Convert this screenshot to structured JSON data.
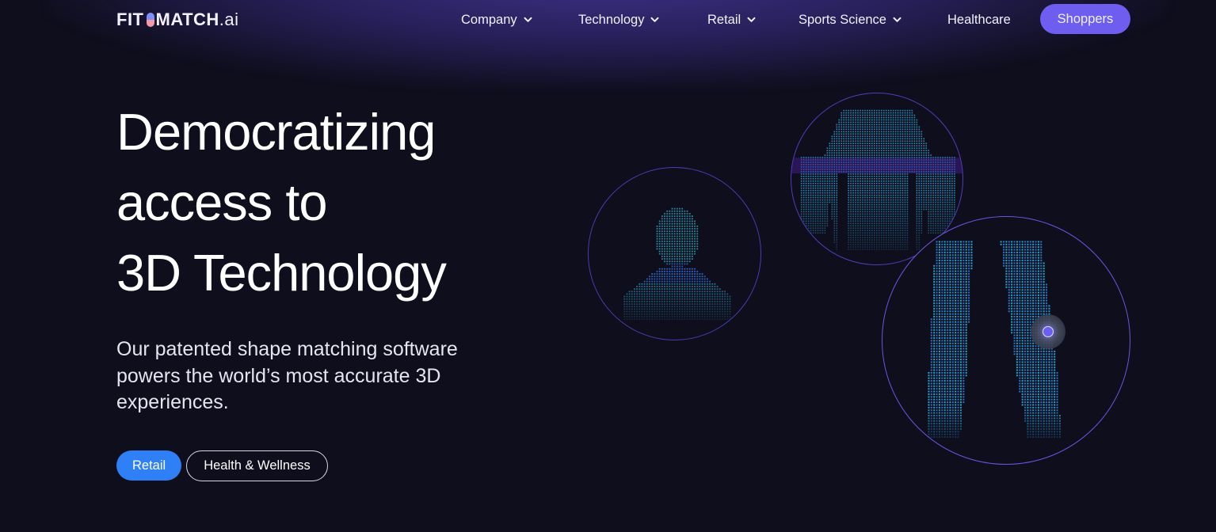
{
  "brand": {
    "logo_left": "FIT",
    "logo_right": "MATCH",
    "logo_suffix": ".ai"
  },
  "nav": {
    "items": [
      {
        "label": "Company",
        "has_dropdown": true,
        "icon": "chevron-down-icon"
      },
      {
        "label": "Technology",
        "has_dropdown": true,
        "icon": "chevron-down-icon"
      },
      {
        "label": "Retail",
        "has_dropdown": true,
        "icon": "chevron-down-icon"
      },
      {
        "label": "Sports Science",
        "has_dropdown": true,
        "icon": "chevron-down-icon"
      },
      {
        "label": "Healthcare",
        "has_dropdown": false
      }
    ],
    "cta_label": "Shoppers"
  },
  "hero": {
    "title_lines": [
      "Democratizing",
      "access to",
      "3D Technology"
    ],
    "subtitle": "Our patented shape matching software powers the world’s most accurate 3D experiences.",
    "buttons": {
      "primary_label": "Retail",
      "secondary_label": "Health & Wellness"
    }
  },
  "visuals": {
    "scans": [
      {
        "name": "head-scan",
        "subject": "head and shoulders point cloud"
      },
      {
        "name": "torso-scan",
        "subject": "torso point cloud"
      },
      {
        "name": "legs-scan",
        "subject": "legs point cloud"
      }
    ],
    "hotspot_icon": "hotspot-marker-icon"
  },
  "colors": {
    "background": "#0f0e1d",
    "accent_purple": "#6f5df0",
    "accent_blue": "#2f7ff7",
    "circle_stroke": "#5b4bd0",
    "point_cloud": "#2aa8d8"
  }
}
